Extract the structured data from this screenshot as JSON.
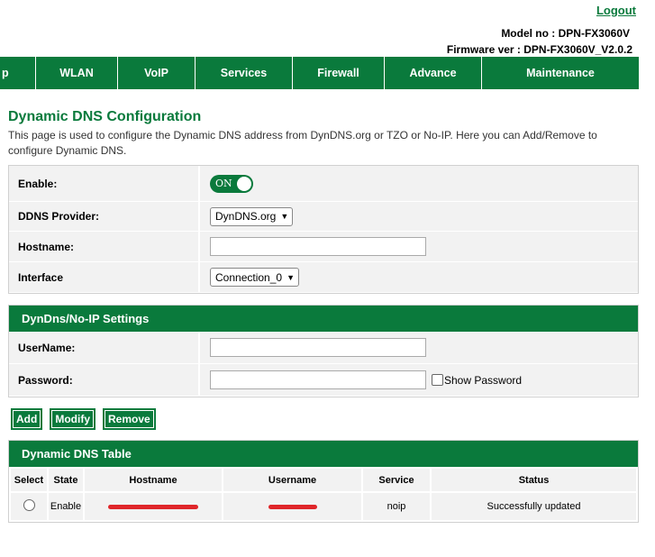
{
  "header": {
    "logout": "Logout",
    "model": "Model no : DPN-FX3060V",
    "firmware": "Firmware ver : DPN-FX3060V_V2.0.2"
  },
  "nav": [
    {
      "label": "p"
    },
    {
      "label": "WLAN"
    },
    {
      "label": "VoIP"
    },
    {
      "label": "Services"
    },
    {
      "label": "Firewall"
    },
    {
      "label": "Advance"
    },
    {
      "label": "Maintenance"
    }
  ],
  "page": {
    "title": "Dynamic DNS Configuration",
    "description": "This page is used to configure the Dynamic DNS address from DynDNS.org or TZO or No-IP. Here you can Add/Remove to configure Dynamic DNS."
  },
  "form": {
    "enable_label": "Enable:",
    "toggle_text": "ON",
    "provider_label": "DDNS Provider:",
    "provider_value": "DynDNS.org",
    "hostname_label": "Hostname:",
    "hostname_value": "",
    "interface_label": "Interface",
    "interface_value": "Connection_0"
  },
  "dyndns": {
    "section_title": "DynDns/No-IP Settings",
    "username_label": "UserName:",
    "username_value": "",
    "password_label": "Password:",
    "password_value": "",
    "show_password": "Show Password"
  },
  "buttons": {
    "add": "Add",
    "modify": "Modify",
    "remove": "Remove"
  },
  "table": {
    "title": "Dynamic DNS Table",
    "headers": [
      "Select",
      "State",
      "Hostname",
      "Username",
      "Service",
      "Status"
    ],
    "rows": [
      {
        "state": "Enable",
        "hostname": "",
        "username": "",
        "service": "noip",
        "status": "Successfully updated"
      }
    ]
  },
  "colors": {
    "brand_green": "#0a7a3c",
    "redaction": "#e0262a"
  }
}
